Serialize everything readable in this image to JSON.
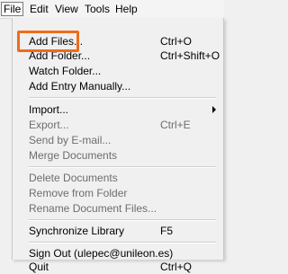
{
  "menubar": {
    "items": [
      "File",
      "Edit",
      "View",
      "Tools",
      "Help"
    ]
  },
  "file_menu": {
    "items": [
      {
        "label": "Add Files...",
        "shortcut": "Ctrl+O"
      },
      {
        "label": "Add Folder...",
        "shortcut": "Ctrl+Shift+O"
      },
      {
        "label": "Watch Folder...",
        "shortcut": ""
      },
      {
        "label": "Add Entry Manually...",
        "shortcut": ""
      },
      {
        "label": "Import...",
        "shortcut": ""
      },
      {
        "label": "Export...",
        "shortcut": "Ctrl+E"
      },
      {
        "label": "Send by E-mail...",
        "shortcut": ""
      },
      {
        "label": "Merge Documents",
        "shortcut": ""
      },
      {
        "label": "Delete Documents",
        "shortcut": ""
      },
      {
        "label": "Remove from Folder",
        "shortcut": ""
      },
      {
        "label": "Rename Document Files...",
        "shortcut": ""
      },
      {
        "label": "Synchronize Library",
        "shortcut": "F5"
      },
      {
        "label": "Sign Out (ulepec@unileon.es)",
        "shortcut": ""
      },
      {
        "label": "Quit",
        "shortcut": "Ctrl+Q"
      }
    ]
  },
  "highlight_color": "#ef6c1a",
  "submenu_icon": "chevron-right-icon"
}
